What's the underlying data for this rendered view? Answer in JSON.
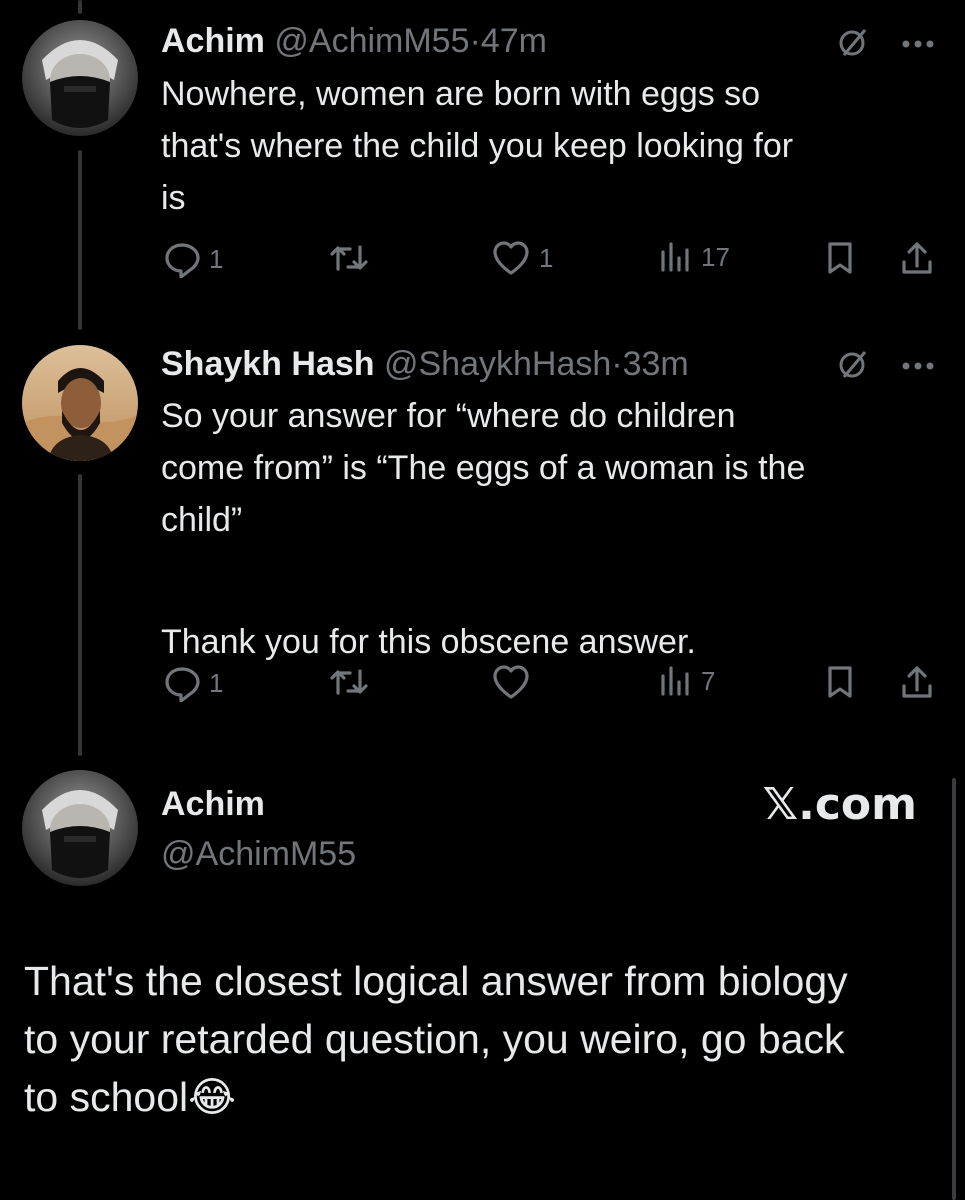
{
  "tweets": [
    {
      "name": "Achim",
      "handle": "@AchimM55",
      "sep": "·",
      "time": "47m",
      "text": [
        "Nowhere, women are born with eggs so",
        "that's where the child you keep looking for",
        "is"
      ],
      "replies": "1",
      "retweets": "",
      "likes": "1",
      "views": "17"
    },
    {
      "name": "Shaykh Hash",
      "handle": "@ShaykhHash",
      "sep": "·",
      "time": "33m",
      "text": [
        "So your answer for “where do children",
        "come from” is “The eggs of a woman is the",
        "child”",
        "",
        "Thank you for this obscene answer."
      ],
      "replies": "1",
      "retweets": "",
      "likes": "",
      "views": "7"
    }
  ],
  "quote": {
    "name": "Achim",
    "handle": "@AchimM55",
    "source": "𝕏.com",
    "text": [
      "That's the closest logical answer from biology",
      "to your retarded question, you weiro, go back",
      "to school😂"
    ]
  },
  "icons": {
    "reply": "reply-icon",
    "retweet": "retweet-icon",
    "like": "heart-icon",
    "views": "views-icon",
    "bookmark": "bookmark-icon",
    "share": "share-icon",
    "grok": "grok-icon",
    "more": "more-icon"
  },
  "colors": {
    "background": "#000000",
    "text": "#e7e9ea",
    "muted": "#71767b",
    "thread_line": "#333639"
  }
}
